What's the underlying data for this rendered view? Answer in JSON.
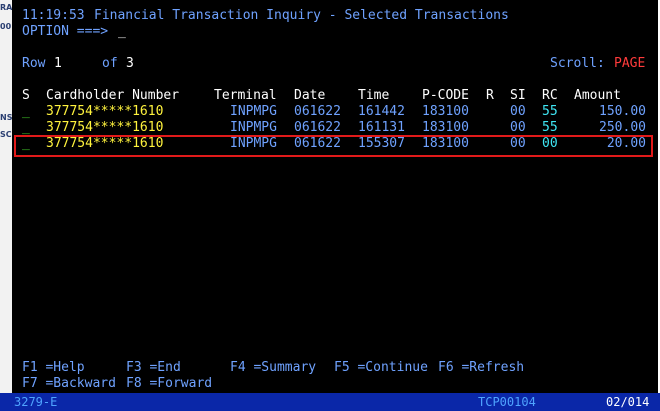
{
  "left_fragments": [
    "RA",
    "00",
    "NS",
    "SC"
  ],
  "header": {
    "time": "11:19:53",
    "title": "Financial Transaction Inquiry - Selected Transactions",
    "option_label": "OPTION ===>",
    "cursor": "_"
  },
  "pager": {
    "row_label": "Row",
    "row_value": "1",
    "of_label": "of",
    "total": "3",
    "scroll_label": "Scroll:",
    "scroll_value": "PAGE"
  },
  "columns": [
    "S",
    "Cardholder Number",
    "Terminal",
    "Date",
    "Time",
    "P-CODE",
    "R",
    "SI",
    "RC",
    "Amount"
  ],
  "rows": [
    {
      "sel": "_",
      "card": "377754*****1610",
      "terminal": "INPMPG",
      "date": "061622",
      "time": "161442",
      "pcode": "183100",
      "r": "",
      "si": "00",
      "rc": "55",
      "amount": "150.00"
    },
    {
      "sel": "_",
      "card": "377754*****1610",
      "terminal": "INPMPG",
      "date": "061622",
      "time": "161131",
      "pcode": "183100",
      "r": "",
      "si": "00",
      "rc": "55",
      "amount": "250.00"
    },
    {
      "sel": "_",
      "card": "377754*****1610",
      "terminal": "INPMPG",
      "date": "061622",
      "time": "155307",
      "pcode": "183100",
      "r": "",
      "si": "00",
      "rc": "00",
      "amount": "20.00"
    }
  ],
  "fkeys": {
    "f1": "F1 =Help",
    "f3": "F3 =End",
    "f4": "F4 =Summary",
    "f5": "F5 =Continue",
    "f6": "F6 =Refresh",
    "f7": "F7 =Backward",
    "f8": "F8 =Forward"
  },
  "status": {
    "left": "3279-E",
    "center": "TCP00104",
    "right": "02/014"
  },
  "colors": {
    "terminal_bg": "#000000",
    "field_text": "#6fa2ff",
    "card_number": "#fff33d",
    "selection": "#44d02a",
    "rc_highlight": "#3fe6f4",
    "scroll_value": "#ff3b3b",
    "highlight_box": "#e21a1a",
    "status_bar": "#0a27a8"
  }
}
